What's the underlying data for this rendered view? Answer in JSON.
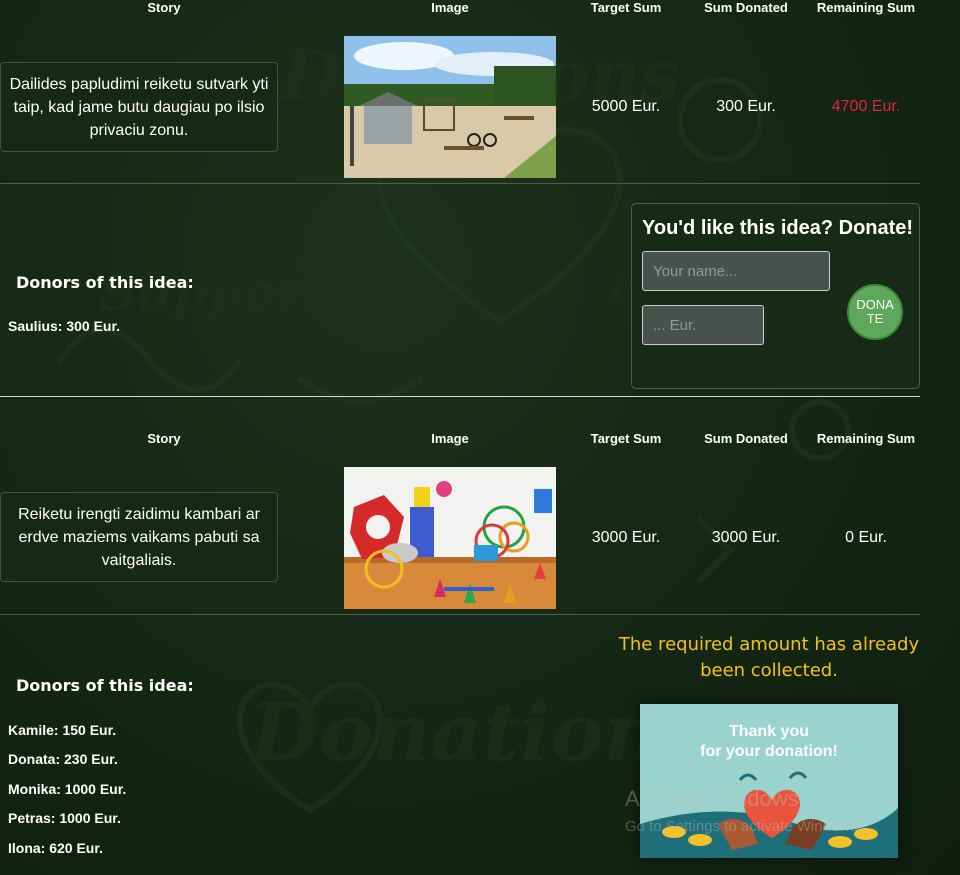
{
  "headers": {
    "story": "Story",
    "image": "Image",
    "target": "Target Sum",
    "donated": "Sum Donated",
    "remaining": "Remaining Sum"
  },
  "ideas": [
    {
      "story": "Dailides papludimi reiketu sutvark yti taip, kad jame butu daugiau po ilsio privaciu zonu.",
      "target": "5000 Eur.",
      "donated": "300 Eur.",
      "remaining": "4700 Eur.",
      "remaining_color": "#e0263a",
      "donors_title": "Donors of this idea:",
      "donors": [
        "Saulius: 300 Eur."
      ]
    },
    {
      "story": "Reiketu irengti zaidimu kambari ar erdve maziems vaikams pabuti sa vaitgaliais.",
      "target": "3000 Eur.",
      "donated": "3000 Eur.",
      "remaining": "0 Eur.",
      "remaining_color": "#ffffff",
      "donors_title": "Donors of this idea:",
      "donors": [
        "Kamile: 150 Eur.",
        "Donata: 230 Eur.",
        "Monika: 1000 Eur.",
        "Petras: 1000 Eur.",
        "Ilona: 620 Eur."
      ]
    }
  ],
  "donate_form": {
    "title": "You'd like this idea? Donate!",
    "name_placeholder": "Your name...",
    "amount_placeholder": "... Eur.",
    "button_label": "DONATE"
  },
  "collected_message": "The required amount has already been collected.",
  "thanks_card": {
    "line1": "Thank you",
    "line2": "for your donation!"
  },
  "watermark": {
    "line1": "Activate Windows",
    "line2": "Go to Settings to activate Windows."
  },
  "colors": {
    "accent_yellow": "#f2c21b",
    "remaining_red": "#e0263a",
    "donate_green": "#5ea85b"
  }
}
